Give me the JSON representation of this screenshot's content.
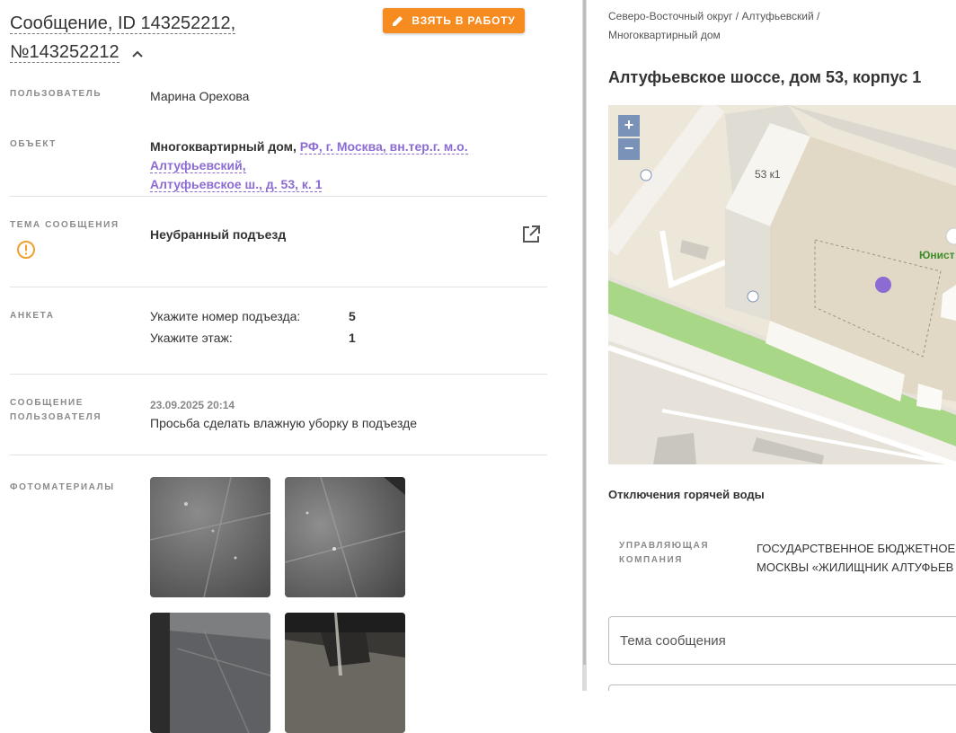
{
  "header": {
    "title_line1": "Сообщение, ID 143252212,",
    "title_line2": "№143252212",
    "take_button": "ВЗЯТЬ В РАБОТУ"
  },
  "fields": {
    "user": {
      "label": "ПОЛЬЗОВАТЕЛЬ",
      "value": "Марина Орехова"
    },
    "object": {
      "label": "ОБЪЕКТ",
      "type": "Многоквартирный дом,",
      "link_line1": "РФ, г. Москва, вн.тер.г. м.о. Алтуфьевский,",
      "link_line2": "Алтуфьевское ш., д. 53, к. 1"
    },
    "topic": {
      "label": "ТЕМА СООБЩЕНИЯ",
      "value": "Неубранный подъезд"
    },
    "survey": {
      "label": "АНКЕТА",
      "rows": [
        {
          "q": "Укажите номер подъезда:",
          "a": "5"
        },
        {
          "q": "Укажите этаж:",
          "a": "1"
        }
      ]
    },
    "message": {
      "label_line1": "СООБЩЕНИЕ",
      "label_line2": "ПОЛЬЗОВАТЕЛЯ",
      "date": "23.09.2025 20:14",
      "text": "Просьба сделать влажную уборку в подъезде"
    },
    "photos": {
      "label": "ФОТОМАТЕРИАЛЫ"
    }
  },
  "right": {
    "breadcrumb": [
      "Северо-Восточный округ",
      "Алтуфьевский",
      "Многоквартирный дом"
    ],
    "separator": "/",
    "address": "Алтуфьевское шоссе, дом 53, корпус 1",
    "map": {
      "building_label": "53 к1",
      "street_label": "Юнист",
      "zoom_in": "+",
      "zoom_out": "−"
    },
    "hot_water": "Отключения горячей воды",
    "company": {
      "label_line1": "УПРАВЛЯЮЩАЯ",
      "label_line2": "КОМПАНИЯ",
      "value_line1": "ГОСУДАРСТВЕННОЕ БЮДЖЕТНОЕ",
      "value_line2": "МОСКВЫ «ЖИЛИЩНИК АЛТУФЬЕВ"
    },
    "topic_input_placeholder": "Тема сообщения"
  },
  "colors": {
    "accent": "#f68b1f",
    "link": "#8c6cd2",
    "marker": "#8c6cd2",
    "warning": "#f0a030"
  }
}
